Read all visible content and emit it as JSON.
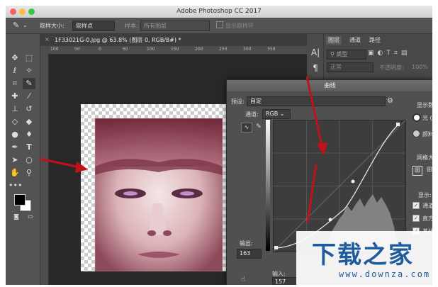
{
  "app": {
    "title": "Adobe Photoshop CC 2017"
  },
  "options_bar": {
    "sample_size_label": "取样大小:",
    "sample_size_value": "取样点",
    "sample_label": "样本:",
    "sample_value": "所有图层",
    "show_ring_label": "显示取样环"
  },
  "document": {
    "tab_title": "1F33021G-0.jpg @ 63.8% (图层 0, RGB/8#) *"
  },
  "ruler": {
    "ticks": [
      "100",
      "50",
      "0",
      "50",
      "100",
      "150",
      "200",
      "250",
      "300",
      "350"
    ]
  },
  "panels": {
    "tabs": [
      "图层",
      "通道",
      "路径"
    ],
    "kind_label": "类型",
    "blend_mode": "正常",
    "opacity_label": "不透明度:",
    "opacity_value": "100%"
  },
  "curves": {
    "title": "曲线",
    "preset_label": "预设:",
    "preset_value": "自定",
    "channel_label": "通道:",
    "channel_value": "RGB",
    "output_label": "输出:",
    "output_value": "163",
    "input_label": "输入:",
    "input_value": "157",
    "display_amount_label": "显示数",
    "light_option": "光 (",
    "pigment_option": "颜料",
    "grid_size_label": "网格大",
    "show_label": "显示:",
    "show_options": [
      "通道",
      "直方",
      "基线"
    ]
  },
  "watermark": {
    "title": "下载之家",
    "url": "www.downza.com"
  },
  "colors": {
    "arrow": "#c0121a",
    "accent": "#1f5c9e"
  }
}
